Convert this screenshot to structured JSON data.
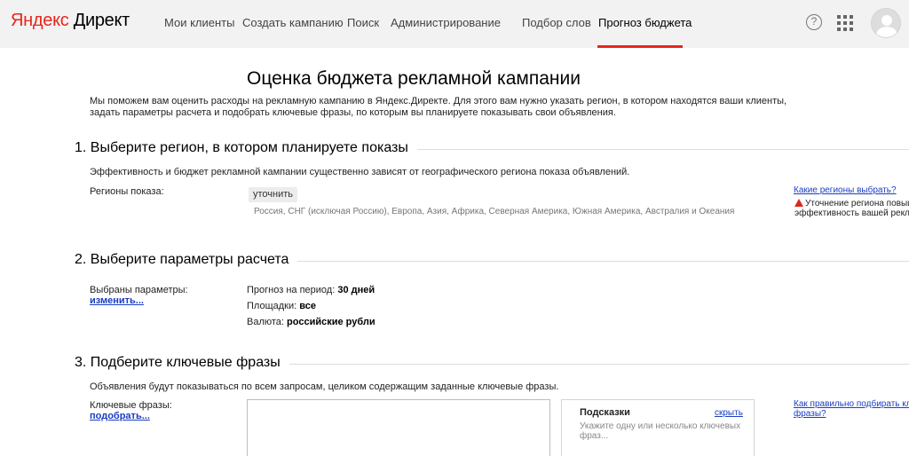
{
  "header": {
    "logo_y": "Яндекс",
    "logo_rest": "Директ",
    "nav": [
      {
        "label": "Мои клиенты"
      },
      {
        "label": "Создать кампанию"
      },
      {
        "label": "Поиск"
      },
      {
        "label": "Администрирование"
      },
      {
        "label": "Подбор слов"
      },
      {
        "label": "Прогноз бюджета"
      }
    ],
    "help_glyph": "?"
  },
  "page": {
    "title": "Оценка бюджета рекламной кампании",
    "intro": "Мы поможем вам оценить расходы на рекламную кампанию в Яндекс.Директе. Для этого вам нужно указать регион, в котором находятся ваши клиенты, задать параметры расчета и подобрать ключевые фразы, по которым вы планируете показывать свои объявления."
  },
  "section1": {
    "title": "1. Выберите регион, в котором планируете показы",
    "desc": "Эффективность и бюджет рекламной кампании существенно зависят от географического региона показа объявлений.",
    "regions_label": "Регионы показа:",
    "refine_button": "уточнить",
    "regions_list": "Россия, СНГ (исключая Россию), Европа, Азия, Африка, Северная Америка, Южная Америка, Австралия и Океания",
    "which_regions_link": "Какие регионы выбрать?",
    "warning_line1": "Уточнение региона повыша",
    "warning_line2": "эффективность вашей реклам"
  },
  "section2": {
    "title": "2. Выберите параметры расчета",
    "selected_label": "Выбраны параметры:",
    "change_link": "изменить...",
    "period_label": "Прогноз на период:",
    "period_value": "30 дней",
    "sites_label": "Площадки:",
    "sites_value": "все",
    "currency_label": "Валюта:",
    "currency_value": "российские рубли"
  },
  "section3": {
    "title": "3. Подберите ключевые фразы",
    "desc": "Объявления будут показываться по всем запросам, целиком содержащим заданные ключевые фразы.",
    "keywords_label": "Ключевые фразы:",
    "pick_link": "подобрать...",
    "hints_title": "Подсказки",
    "hints_hide": "скрыть",
    "hints_text": "Укажите одну или несколько ключевых фраз...",
    "howto_link_line1": "Как правильно подбирать клю",
    "howto_link_line2": "фразы?"
  }
}
